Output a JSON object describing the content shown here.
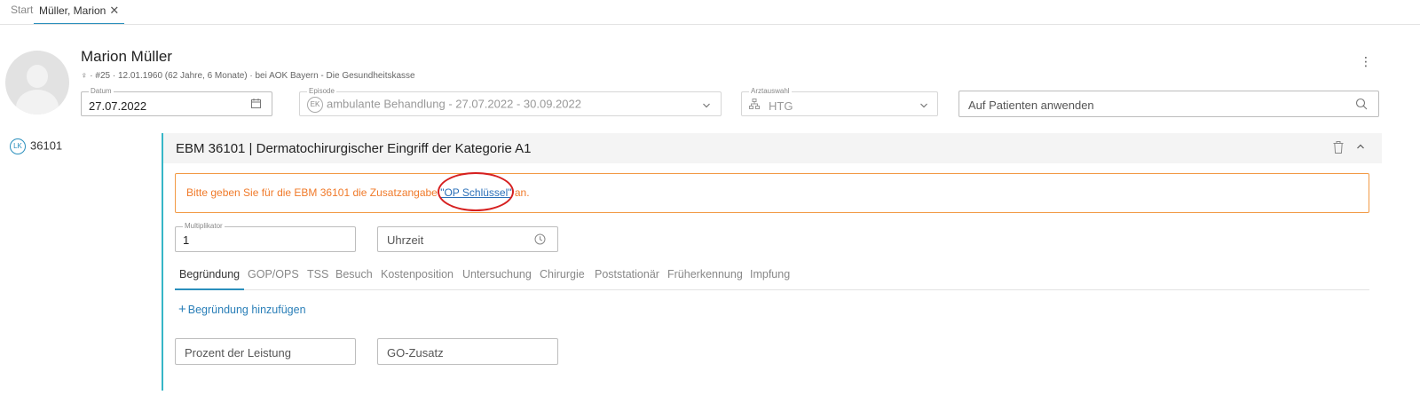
{
  "tabs": {
    "start": "Start",
    "patient": "Müller, Marion",
    "close": "✕"
  },
  "patient": {
    "name": "Marion Müller",
    "meta": "♀ · #25 · 12.01.1960 (62 Jahre, 6 Monate) · bei AOK Bayern - Die Gesundheitskasse",
    "more": "⋮"
  },
  "header_fields": {
    "datum_label": "Datum",
    "datum_value": "27.07.2022",
    "episode_label": "Episode",
    "episode_badge": "EK",
    "episode_value": "ambulante Behandlung - 27.07.2022 - 30.09.2022",
    "arzt_label": "Arztauswahl",
    "arzt_value": "HTG",
    "apply_placeholder": "Auf Patienten anwenden"
  },
  "service_list": {
    "badge": "LK",
    "code": "36101"
  },
  "section": {
    "title": "EBM 36101 | Dermatochirurgischer Eingriff der Kategorie A1"
  },
  "warning": {
    "before": "Bitte geben Sie für die EBM 36101 die Zusatzangabe ",
    "link": "\"OP Schlüssel\"",
    "after": " an."
  },
  "fields": {
    "multiplikator_label": "Multiplikator",
    "multiplikator_value": "1",
    "uhrzeit_placeholder": "Uhrzeit",
    "prozent_placeholder": "Prozent der Leistung",
    "gozusatz_placeholder": "GO-Zusatz"
  },
  "subtabs": [
    "Begründung",
    "GOP/OPS",
    "TSS",
    "Besuch",
    "Kostenposition",
    "Untersuchung",
    "Chirurgie",
    "Poststationär",
    "Früherkennung",
    "Impfung"
  ],
  "add_reason": "Begründung hinzufügen",
  "colors": {
    "accent": "#2a8fbd",
    "warning": "#f07a2a",
    "highlight": "#d62020"
  }
}
